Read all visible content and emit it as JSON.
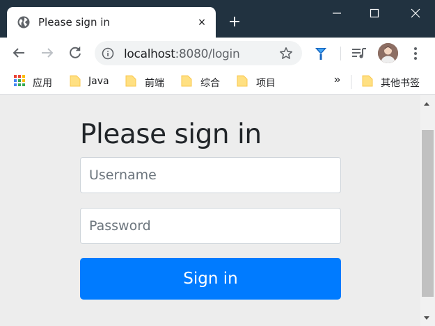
{
  "colors": {
    "titlebar": "#213240",
    "primary_button": "#007bff",
    "page_background": "#ededed",
    "heading": "#212529"
  },
  "tab": {
    "title": "Please sign in",
    "close_glyph": "×",
    "icon": "globe-icon"
  },
  "window_controls": [
    "minimize-icon",
    "maximize-icon",
    "close-icon"
  ],
  "address_bar": {
    "host": "localhost",
    "port_path": ":8080/login"
  },
  "bookmarks": {
    "apps_label": "应用",
    "items": [
      "Java",
      "前端",
      "综合",
      "项目"
    ],
    "overflow": "»",
    "other": "其他书签"
  },
  "page": {
    "heading": "Please sign in",
    "username_placeholder": "Username",
    "password_placeholder": "Password",
    "signin_label": "Sign in"
  }
}
